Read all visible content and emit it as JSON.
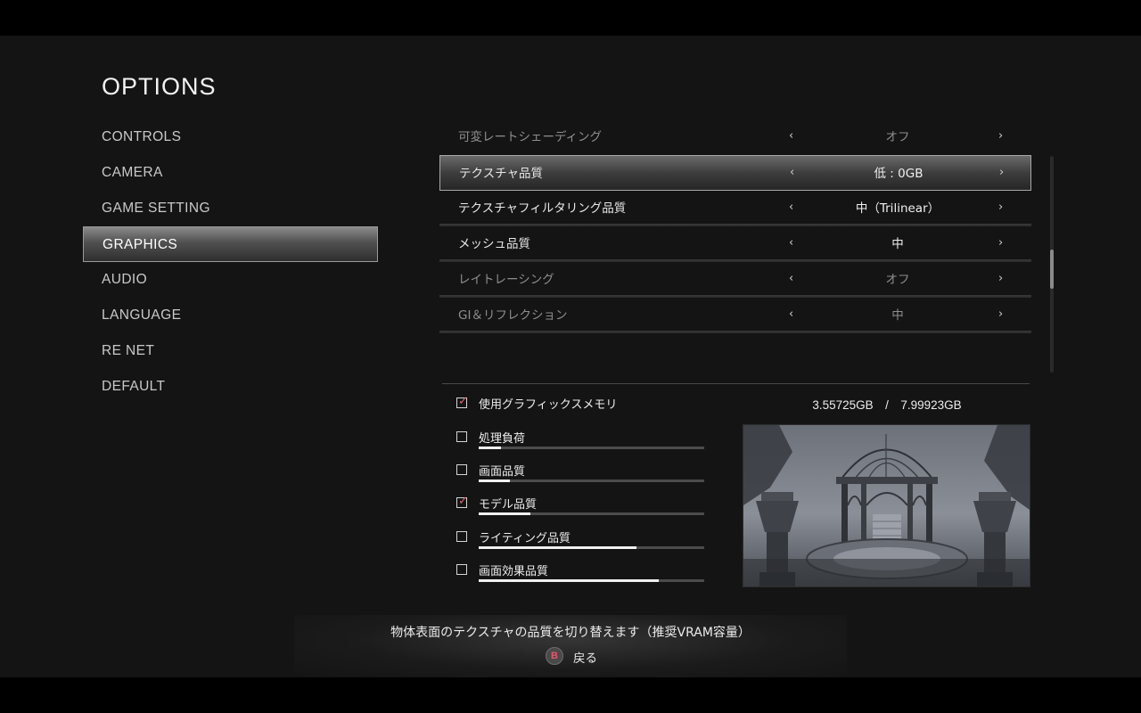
{
  "title": "OPTIONS",
  "menu": {
    "items": [
      {
        "label": "CONTROLS"
      },
      {
        "label": "CAMERA"
      },
      {
        "label": "GAME SETTING"
      },
      {
        "label": "GRAPHICS"
      },
      {
        "label": "AUDIO"
      },
      {
        "label": "LANGUAGE"
      },
      {
        "label": "RE NET"
      },
      {
        "label": "DEFAULT"
      }
    ],
    "selected": "GRAPHICS"
  },
  "settings": [
    {
      "label": "可変レートシェーディング",
      "value": "オフ",
      "state": "disabled"
    },
    {
      "label": "テクスチャ品質",
      "value": "低 : 0GB",
      "state": "selected"
    },
    {
      "label": "テクスチャフィルタリング品質",
      "value": "中（Trilinear）",
      "state": "normal"
    },
    {
      "label": "メッシュ品質",
      "value": "中",
      "state": "normal"
    },
    {
      "label": "レイトレーシング",
      "value": "オフ",
      "state": "disabled"
    },
    {
      "label": "GI＆リフレクション",
      "value": "中",
      "state": "disabled"
    }
  ],
  "arrows": {
    "left": "‹",
    "right": "›"
  },
  "vram": {
    "label": "使用グラフィックスメモリ",
    "checked": true,
    "readout": "3.55725GB　/　7.99923GB"
  },
  "load_items": [
    {
      "label": "処理負荷",
      "checked": false,
      "level": 0.1
    },
    {
      "label": "画面品質",
      "checked": false,
      "level": 0.14
    },
    {
      "label": "モデル品質",
      "checked": true,
      "level": 0.23
    },
    {
      "label": "ライティング品質",
      "checked": false,
      "level": 0.7
    },
    {
      "label": "画面効果品質",
      "checked": false,
      "level": 0.8
    }
  ],
  "check_glyph": "✓",
  "footer": {
    "help": "物体表面のテクスチャの品質を切り替えます（推奨VRAM容量）",
    "back_button": "B",
    "back_label": "戻る"
  },
  "colors": {
    "accent": "#e05a6e",
    "panel": "#141414",
    "text": "#ededed",
    "dim_text": "#8e8e8e"
  }
}
